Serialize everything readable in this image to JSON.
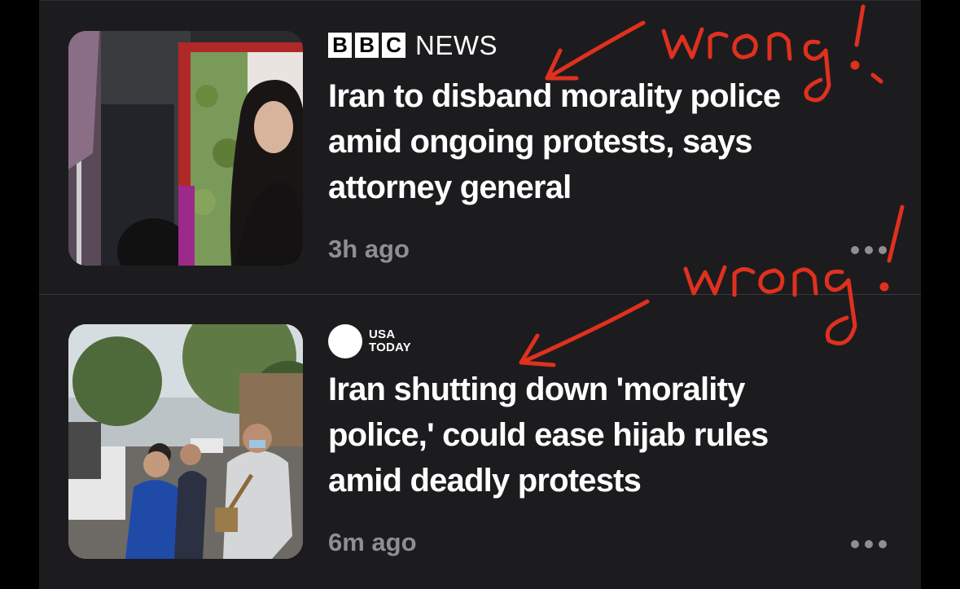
{
  "cards": [
    {
      "source": {
        "letters": [
          "B",
          "B",
          "C"
        ],
        "name": "NEWS"
      },
      "headline": "Iran to disband morality police amid ongoing protests, says attorney general",
      "time": "3h ago",
      "thumbnail_icon": "protest-portrait-photo",
      "more_icon": "ellipsis-icon"
    },
    {
      "source": {
        "line1": "USA",
        "line2": "TODAY"
      },
      "headline": "Iran shutting down 'morality police,' could ease hijab rules amid deadly protests",
      "time": "6m ago",
      "thumbnail_icon": "street-protest-photo",
      "more_icon": "ellipsis-icon"
    }
  ],
  "annotations": [
    {
      "text": "wrong!",
      "color": "#e0301e"
    },
    {
      "text": "wrong!",
      "color": "#e0301e"
    }
  ],
  "colors": {
    "panel": "#1c1c1e",
    "secondary_text": "#8e8e93",
    "annotation_red": "#e0301e"
  }
}
